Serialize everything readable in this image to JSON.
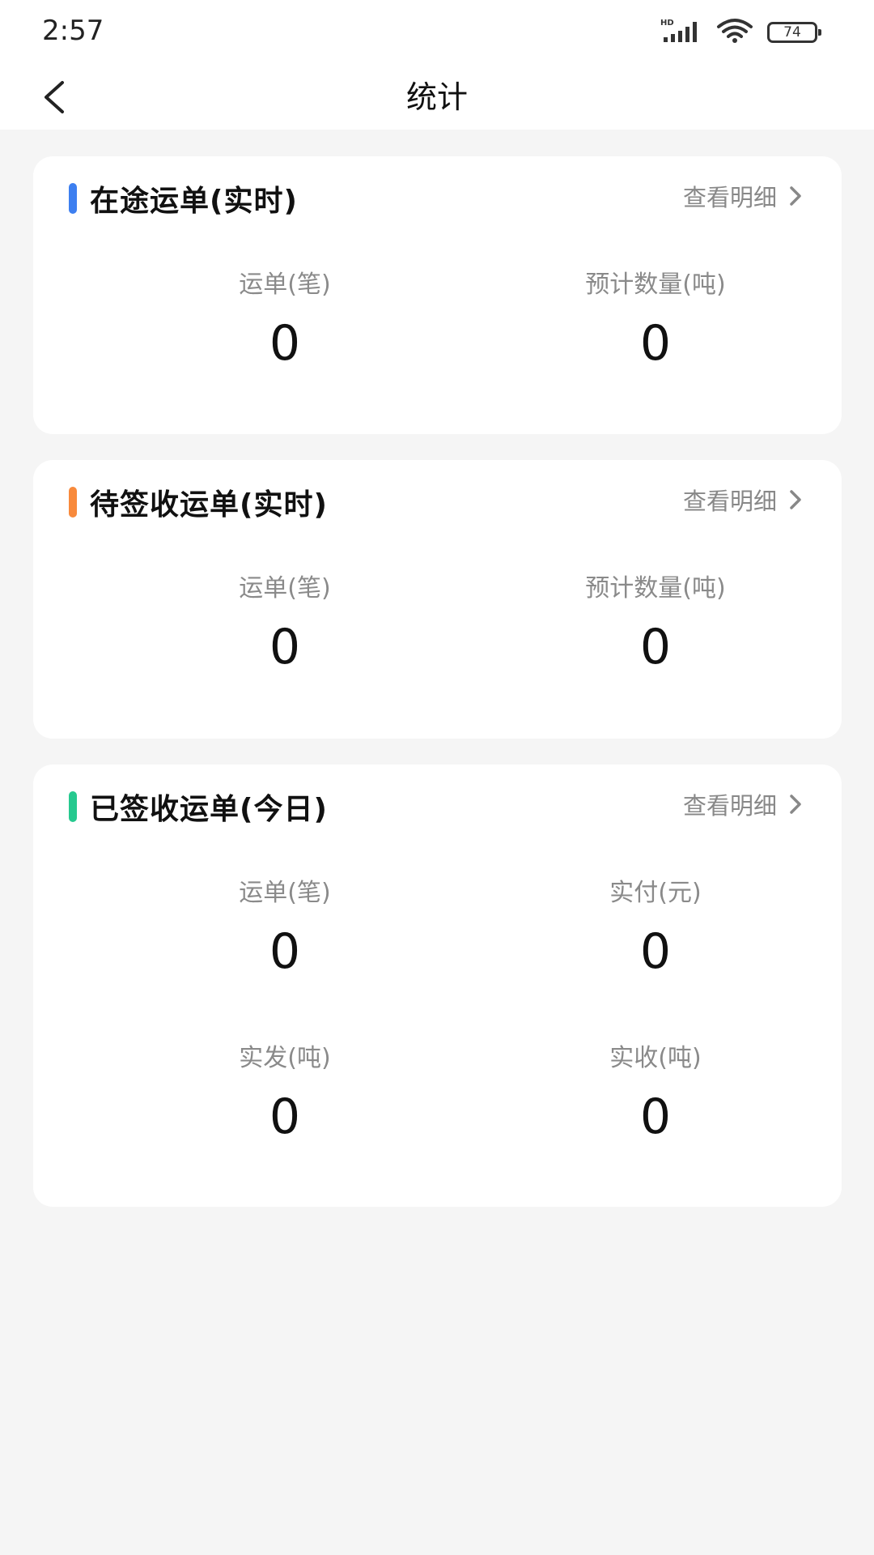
{
  "status_bar": {
    "time": "2:57",
    "network_label": "HD",
    "battery_level": "74",
    "icons": [
      "signal-icon",
      "wifi-icon",
      "battery-icon"
    ]
  },
  "nav": {
    "title": "统计",
    "back_icon": "chevron-left-icon"
  },
  "colors": {
    "in_transit_accent": "#3d7ff0",
    "pending_accent": "#f88a3c",
    "signed_accent": "#26c98f"
  },
  "cards": [
    {
      "title": "在途运单(实时)",
      "link_label": "查看明细",
      "stats": [
        {
          "label": "运单(笔)",
          "value": "0"
        },
        {
          "label": "预计数量(吨)",
          "value": "0"
        }
      ]
    },
    {
      "title": "待签收运单(实时)",
      "link_label": "查看明细",
      "stats": [
        {
          "label": "运单(笔)",
          "value": "0"
        },
        {
          "label": "预计数量(吨)",
          "value": "0"
        }
      ]
    },
    {
      "title": "已签收运单(今日)",
      "link_label": "查看明细",
      "stats": [
        {
          "label": "运单(笔)",
          "value": "0"
        },
        {
          "label": "实付(元)",
          "value": "0"
        },
        {
          "label": "实发(吨)",
          "value": "0"
        },
        {
          "label": "实收(吨)",
          "value": "0"
        }
      ]
    }
  ]
}
